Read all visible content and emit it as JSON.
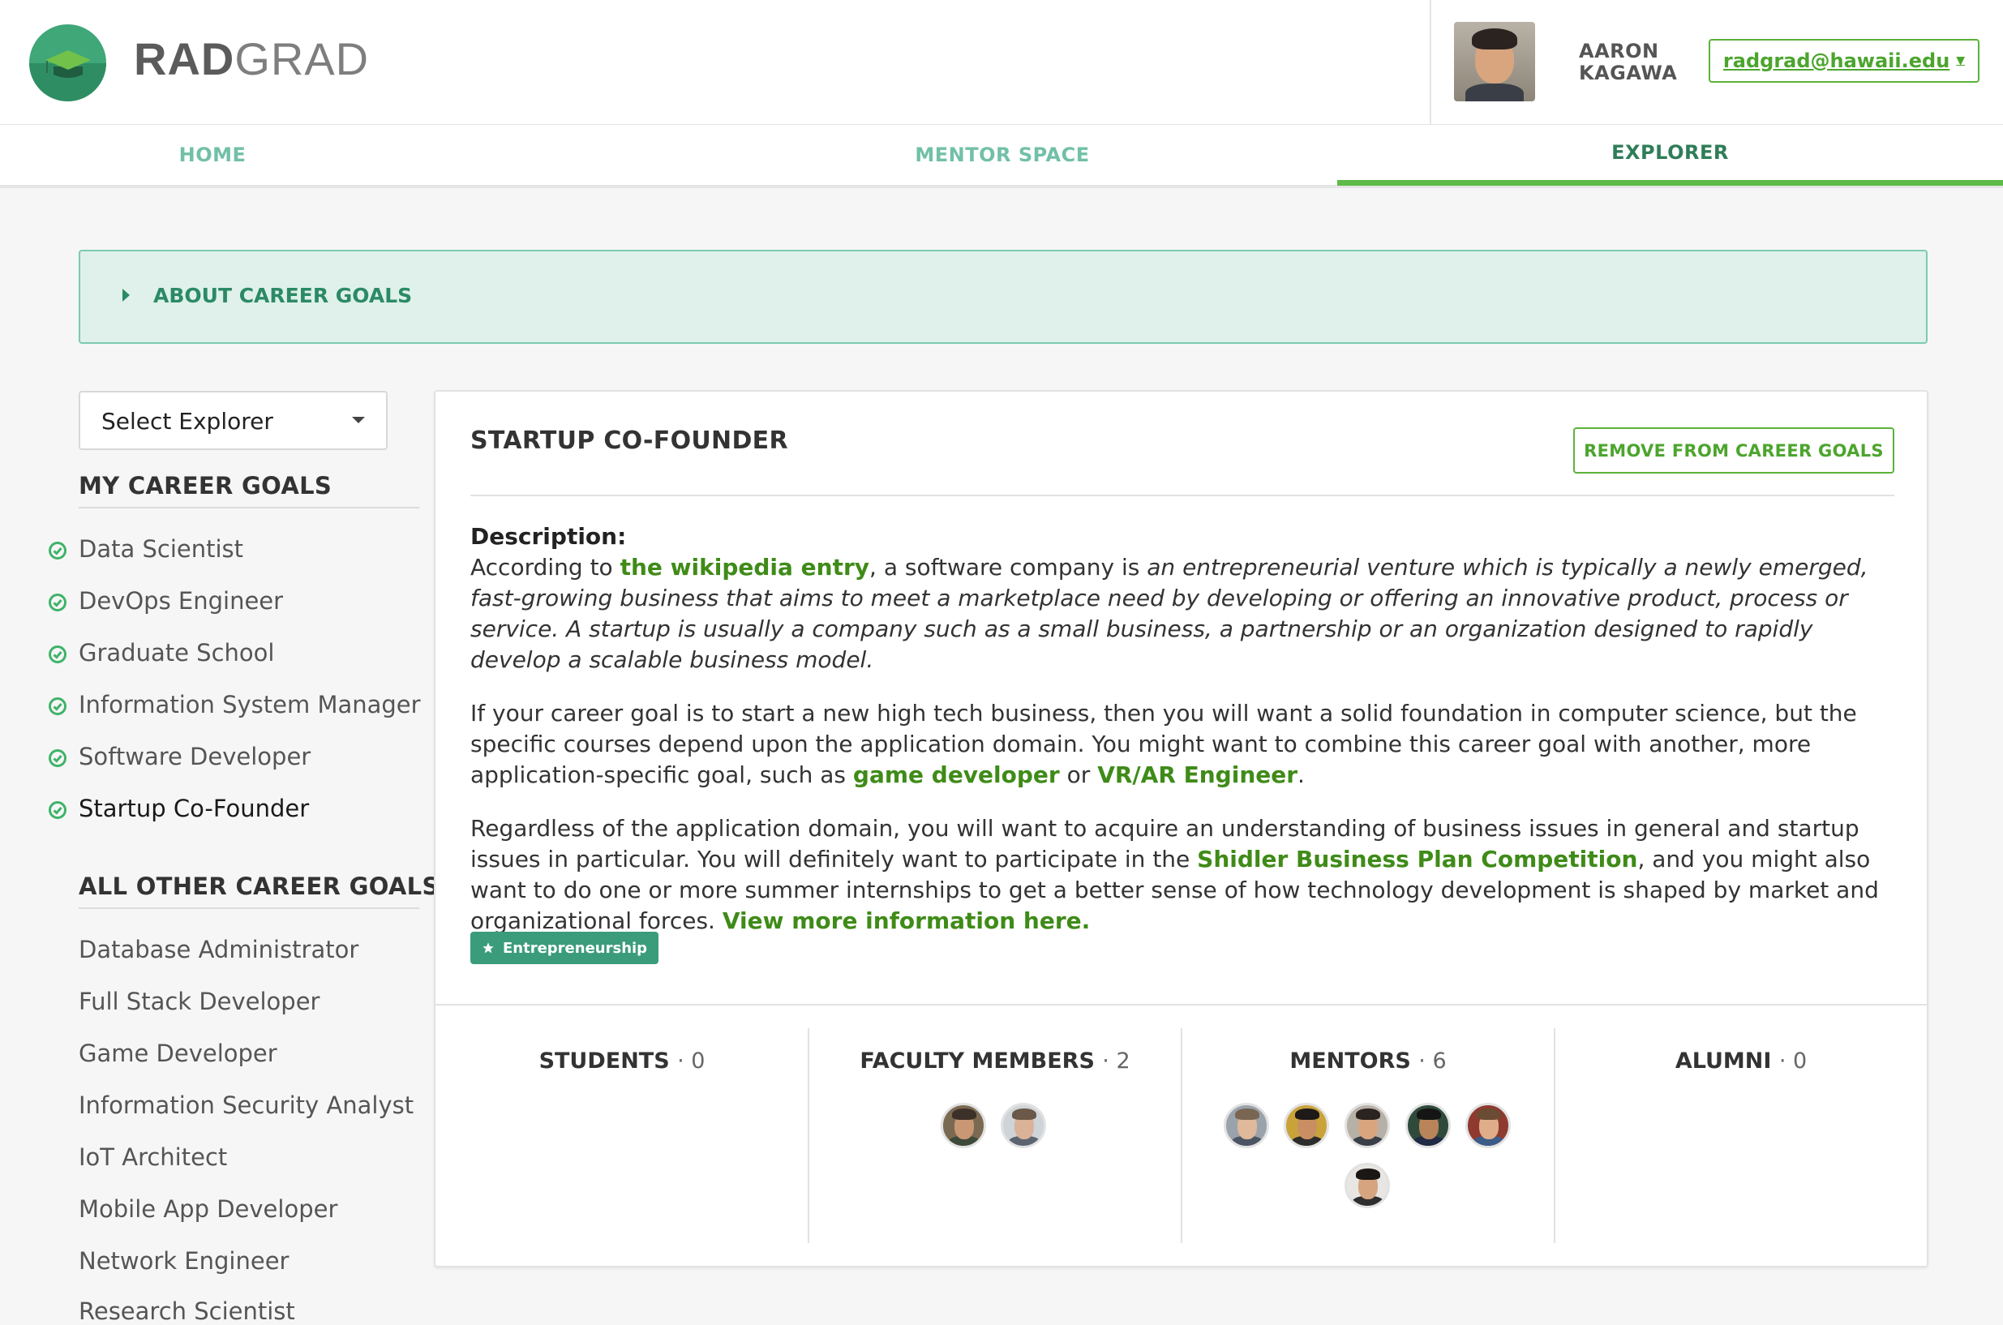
{
  "header": {
    "brand_bold": "RAD",
    "brand_rest": "GRAD",
    "user_first": "AARON",
    "user_last": "KAGAWA",
    "user_email": "radgrad@hawaii.edu"
  },
  "tabs": [
    {
      "label": "HOME",
      "active": false
    },
    {
      "label": "MENTOR SPACE",
      "active": false
    },
    {
      "label": "EXPLORER",
      "active": true
    }
  ],
  "about": {
    "label": "ABOUT CAREER GOALS"
  },
  "sidebar": {
    "select_label": "Select Explorer",
    "my_heading": "MY CAREER GOALS",
    "my_goals": [
      "Data Scientist",
      "DevOps Engineer",
      "Graduate School",
      "Information System Manager",
      "Software Developer",
      "Startup Co-Founder"
    ],
    "other_heading": "ALL OTHER CAREER GOALS",
    "other_goals": [
      "Database Administrator",
      "Full Stack Developer",
      "Game Developer",
      "Information Security Analyst",
      "IoT Architect",
      "Mobile App Developer",
      "Network Engineer",
      "Research Scientist"
    ]
  },
  "detail": {
    "title": "STARTUP CO-FOUNDER",
    "remove_label": "REMOVE FROM CAREER GOALS",
    "description_heading": "Description:",
    "p1_a": "According to ",
    "p1_link": "the wikipedia entry",
    "p1_b": ", a software company is ",
    "p1_em": "an entrepreneurial venture which is typically a newly emerged, fast-growing business that aims to meet a marketplace need by developing or offering an innovative product, process or service. A startup is usually a company such as a small business, a partnership or an organization designed to rapidly develop a scalable business model.",
    "p2_a": "If your career goal is to start a new high tech business, then you will want a solid foundation in computer science, but the specific courses depend upon the application domain. You might want to combine this career goal with another, more application-specific goal, such as ",
    "p2_link1": "game developer",
    "p2_b": " or ",
    "p2_link2": "VR/AR Engineer",
    "p2_c": ".",
    "p3_a": "Regardless of the application domain, you will want to acquire an understanding of business issues in general and startup issues in particular. You will definitely want to participate in the ",
    "p3_link1": "Shidler Business Plan Competition",
    "p3_b": ", and you might also want to do one or more summer internships to get a better sense of how technology development is shaped by market and organizational forces. ",
    "p3_link2": "View more information here.",
    "tag": "Entrepreneurship"
  },
  "stats": {
    "students_label": "STUDENTS",
    "students_count": "· 0",
    "faculty_label": "FACULTY MEMBERS",
    "faculty_count": "· 2",
    "mentors_label": "MENTORS",
    "mentors_count": "· 6",
    "alumni_label": "ALUMNI",
    "alumni_count": "· 0"
  },
  "colors": {
    "accent_green": "#5cb23a",
    "link_green": "#3f8b18",
    "teal": "#2b8a66",
    "tag_bg": "#3b9c7c",
    "about_bg": "#dff1ea"
  },
  "icons": {
    "goal_check": "check-circle-icon",
    "tag_star": "star-icon",
    "about_toggle": "triangle-right-icon",
    "select_caret": "caret-down-icon",
    "logo": "graduation-cap-icon"
  }
}
